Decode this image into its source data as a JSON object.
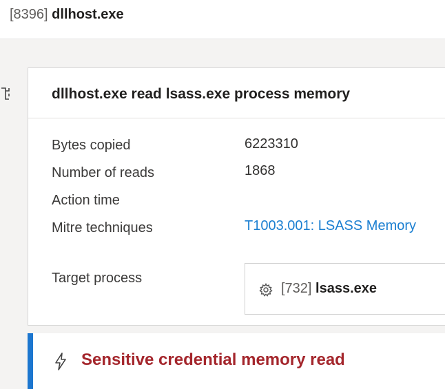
{
  "process": {
    "pid": "[8396]",
    "name": "dllhost.exe"
  },
  "event": {
    "title": "dllhost.exe read lsass.exe process memory",
    "details": [
      {
        "label": "Bytes copied",
        "value": "6223310"
      },
      {
        "label": "Number of reads",
        "value": "1868"
      },
      {
        "label": "Action time",
        "value": ""
      },
      {
        "label": "Mitre techniques",
        "value": "T1003.001: LSASS Memory"
      }
    ],
    "target": {
      "label": "Target process",
      "pid": "[732]",
      "name": "lsass.exe",
      "icon": "gear-icon"
    }
  },
  "alert": {
    "text": "Sensitive credential memory read",
    "icon": "lightning-icon"
  },
  "colors": {
    "link": "#1b7fd1",
    "alert_text": "#a4262c",
    "alert_accent": "#1c76cf"
  }
}
